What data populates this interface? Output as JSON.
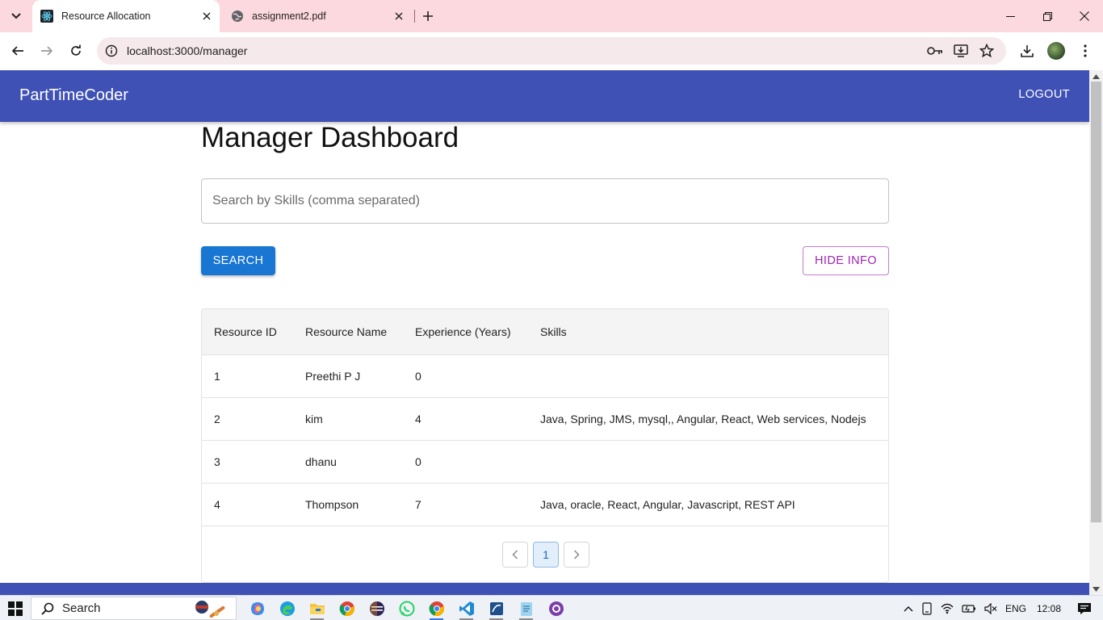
{
  "browser": {
    "tabs": [
      {
        "title": "Resource Allocation",
        "active": true,
        "icon": "react-favicon-icon"
      },
      {
        "title": "assignment2.pdf",
        "active": false,
        "icon": "globe-favicon-icon"
      }
    ],
    "url": "localhost:3000/manager"
  },
  "app": {
    "title": "PartTimeCoder",
    "logout_label": "LOGOUT",
    "brand_color": "#3f51b5"
  },
  "main": {
    "page_title": "Manager Dashboard",
    "search_placeholder": "Search by Skills (comma separated)",
    "search_value": "",
    "search_button": "SEARCH",
    "hide_info_button": "HIDE INFO",
    "table": {
      "headers": [
        "Resource ID",
        "Resource Name",
        "Experience (Years)",
        "Skills"
      ],
      "rows": [
        [
          "1",
          "Preethi P J",
          "0",
          ""
        ],
        [
          "2",
          "kim",
          "4",
          "Java, Spring, JMS, mysql,, Angular, React, Web services, Nodejs"
        ],
        [
          "3",
          "dhanu",
          "0",
          ""
        ],
        [
          "4",
          "Thompson",
          "7",
          "Java, oracle, React, Angular, Javascript, REST API"
        ]
      ]
    },
    "pagination": {
      "current_page": "1"
    }
  },
  "taskbar": {
    "search_label": "Search",
    "language": "ENG",
    "time": "12:08"
  }
}
